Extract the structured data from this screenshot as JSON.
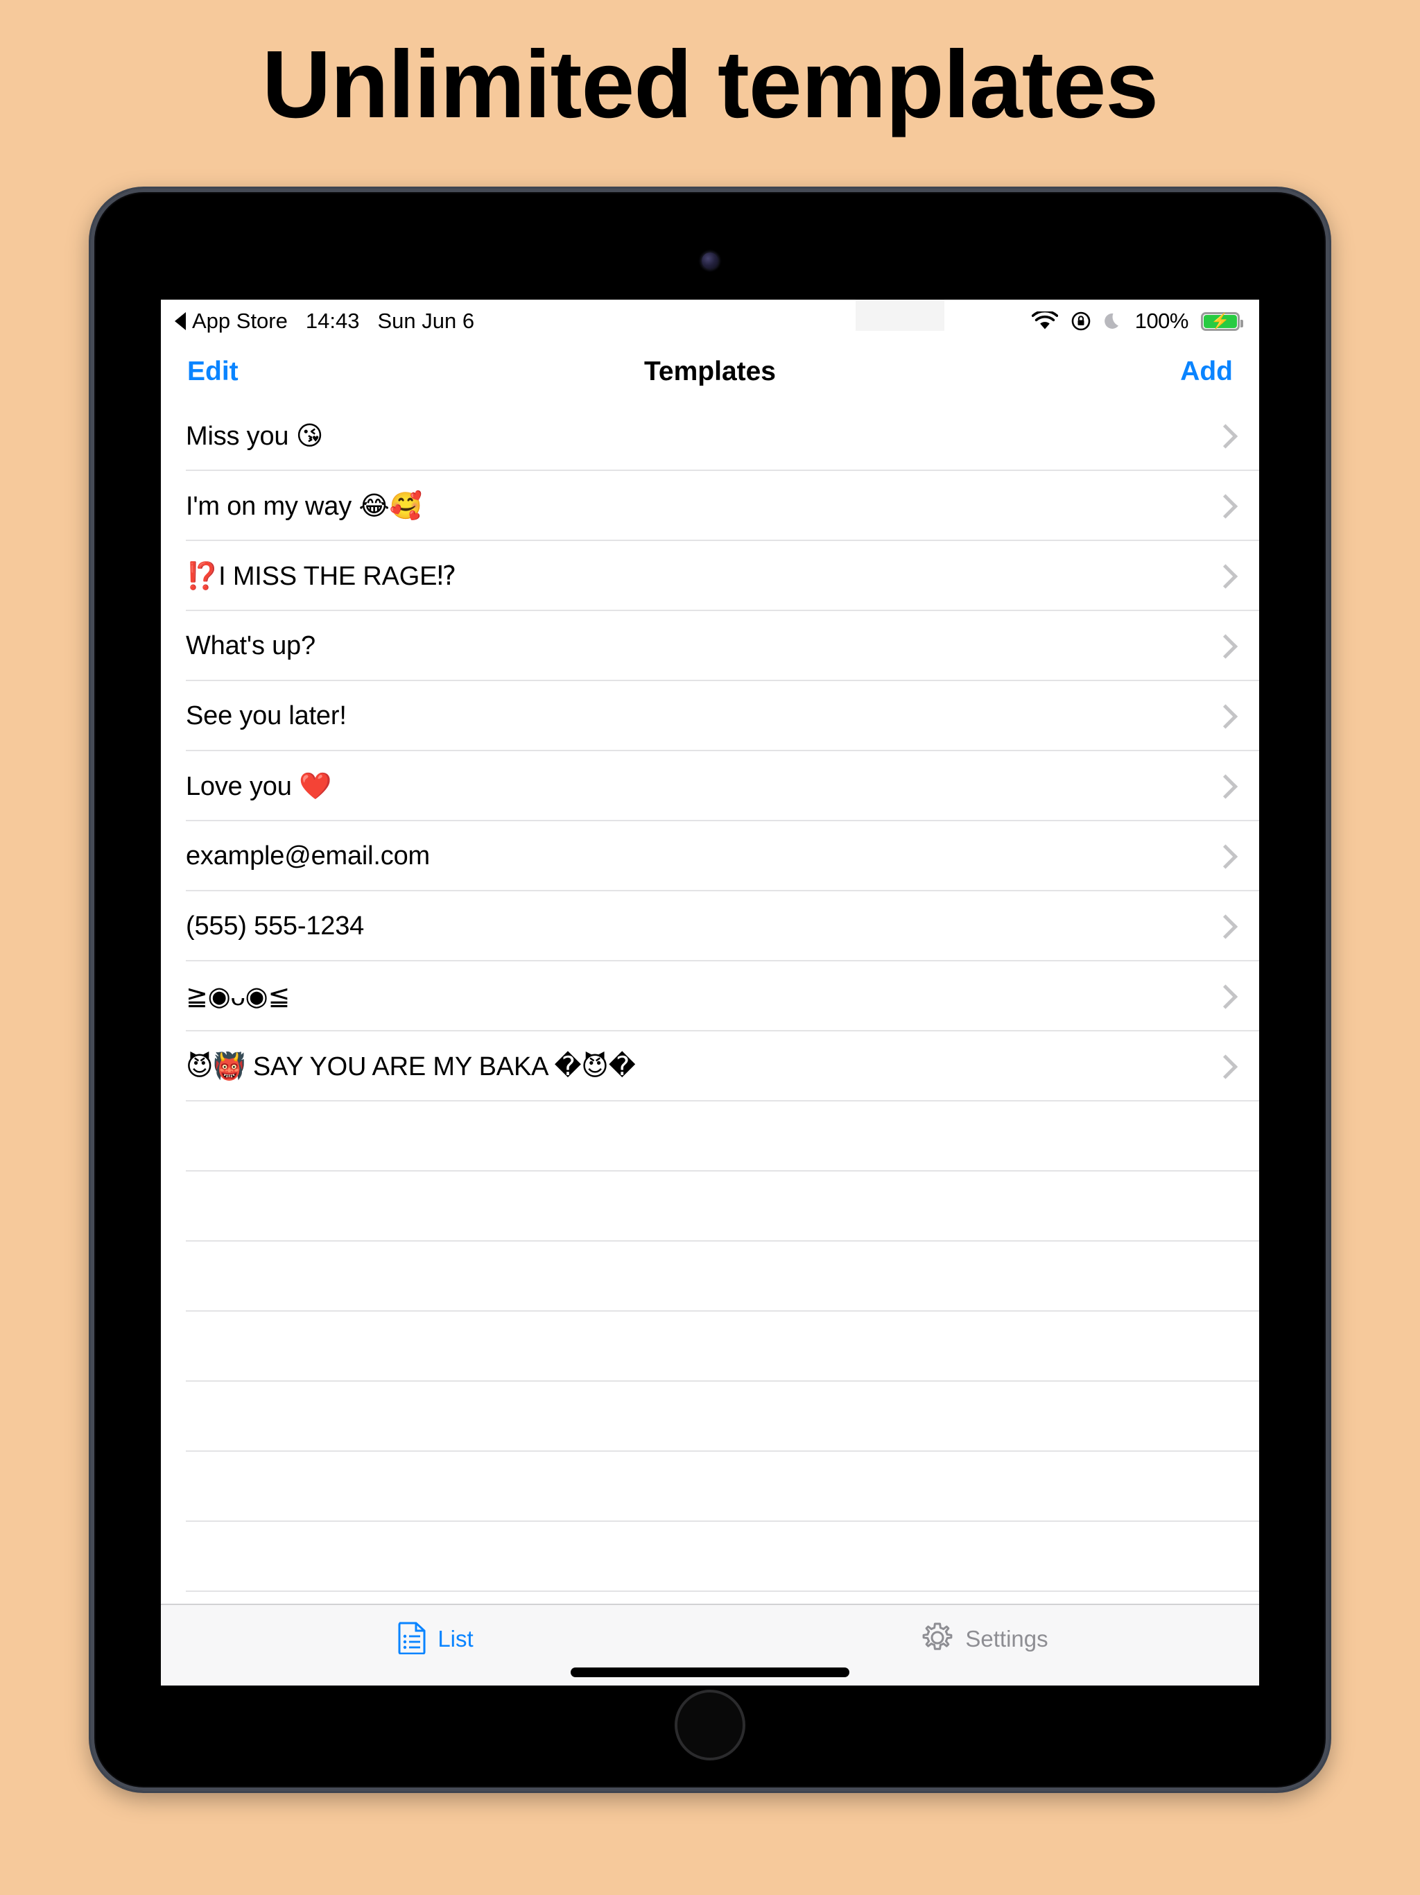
{
  "headline": "Unlimited templates",
  "theme": {
    "background": "#f6c99b",
    "accent": "#0a84ff",
    "inactive": "#8e8e93",
    "separator": "#e3e3e5",
    "battery_green": "#28cb42"
  },
  "device": {
    "front_camera_icon": "front-camera",
    "home_button_icon": "home-button"
  },
  "status_bar": {
    "back_label": "App Store",
    "back_arrow_icon": "back-triangle-icon",
    "time": "14:43",
    "date": "Sun Jun 6",
    "wifi_icon": "wifi-icon",
    "rotation_lock_icon": "rotation-lock-icon",
    "do_not_disturb_icon": "moon-icon",
    "battery_percent": "100%",
    "battery_icon": "battery-charging-icon",
    "charging_bolt": "⚡"
  },
  "nav_bar": {
    "edit_label": "Edit",
    "title": "Templates",
    "add_label": "Add"
  },
  "list": {
    "chevron_icon": "chevron-right-icon",
    "rows": [
      {
        "text": "Miss you ",
        "emoji": "😘",
        "emoji_pos": "after"
      },
      {
        "text": "I'm on my way ",
        "emoji": "😂🥰",
        "emoji_pos": "after"
      },
      {
        "text": "I MISS THE RAGE",
        "emoji": "⁉️",
        "emoji_pos": "both"
      },
      {
        "text": "What's up?",
        "emoji": "",
        "emoji_pos": "none"
      },
      {
        "text": "See you later!",
        "emoji": "",
        "emoji_pos": "none"
      },
      {
        "text": "Love you ",
        "emoji": "❤️",
        "emoji_pos": "after"
      },
      {
        "text": "example@email.com",
        "emoji": "",
        "emoji_pos": "none"
      },
      {
        "text": "(555) 555-1234",
        "emoji": "",
        "emoji_pos": "none"
      },
      {
        "text": "≧◉ᴗ◉≦",
        "emoji": "",
        "emoji_pos": "none"
      },
      {
        "text": " SAY YOU ARE MY BAKA ",
        "emoji": "😈👹",
        "emoji_pos": "both"
      }
    ],
    "empty_row_count": 7
  },
  "tab_bar": {
    "tabs": [
      {
        "label": "List",
        "icon": "document-list-icon",
        "active": true
      },
      {
        "label": "Settings",
        "icon": "gear-icon",
        "active": false
      }
    ]
  }
}
